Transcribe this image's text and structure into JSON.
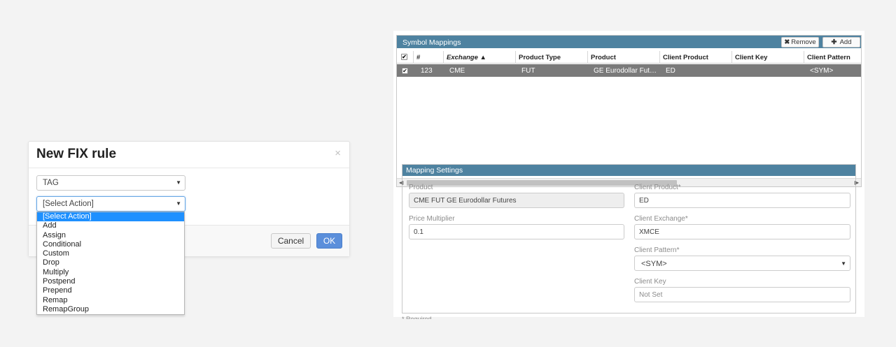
{
  "modal": {
    "title": "New FIX rule",
    "close_glyph": "×",
    "field_select": {
      "value": "TAG"
    },
    "action_select": {
      "value": "[Select Action]"
    },
    "action_options": [
      "[Select Action]",
      "Add",
      "Assign",
      "Conditional",
      "Custom",
      "Drop",
      "Multiply",
      "Postpend",
      "Prepend",
      "Remap",
      "RemapGroup"
    ],
    "cancel_label": "Cancel",
    "ok_label": "OK"
  },
  "symbol_mappings": {
    "title": "Symbol Mappings",
    "remove_label": "Remove",
    "add_label": "Add",
    "columns": [
      "#",
      "Exchange",
      "Product Type",
      "Product",
      "Client Product",
      "Client Key",
      "Client Pattern"
    ],
    "rows": [
      {
        "id": "123",
        "exchange": "CME",
        "product_type": "FUT",
        "product": "GE Eurodollar Fut…",
        "client_product": "ED",
        "client_key": "",
        "client_pattern": "<SYM>"
      }
    ]
  },
  "mapping_settings": {
    "title": "Mapping Settings",
    "product_label": "Product",
    "product_value": "CME FUT GE Eurodollar Futures",
    "price_multiplier_label": "Price Multiplier",
    "price_multiplier_value": "0.1",
    "client_product_label": "Client Product*",
    "client_product_value": "ED",
    "client_exchange_label": "Client Exchange*",
    "client_exchange_value": "XMCE",
    "client_pattern_label": "Client Pattern*",
    "client_pattern_value": "<SYM>",
    "client_key_label": "Client Key",
    "client_key_value": "Not Set"
  },
  "footnote": "* Required"
}
